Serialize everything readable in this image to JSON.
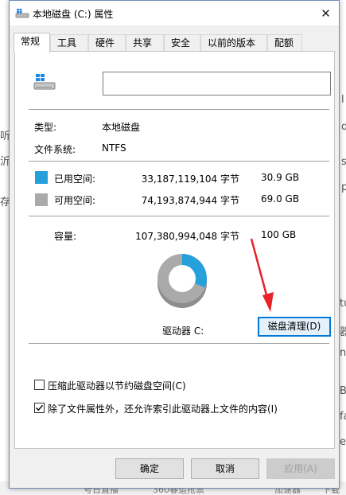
{
  "background": {
    "left_chars": [
      "听",
      "沂",
      "存"
    ],
    "right_chars": [
      "l",
      "d",
      "s",
      "p",
      "tu",
      "器",
      "ng",
      "Be",
      "fa",
      "e"
    ],
    "taskbar_items": [
      "号日直播",
      "360春运抢票",
      "加速器",
      "下载"
    ]
  },
  "window": {
    "title": "本地磁盘 (C:) 属性",
    "close_symbol": "✕"
  },
  "tabs": [
    {
      "label": "常规",
      "active": true
    },
    {
      "label": "工具",
      "active": false
    },
    {
      "label": "硬件",
      "active": false
    },
    {
      "label": "共享",
      "active": false
    },
    {
      "label": "安全",
      "active": false
    },
    {
      "label": "以前的版本",
      "active": false
    },
    {
      "label": "配额",
      "active": false
    }
  ],
  "general": {
    "volume_name_value": "",
    "type_label": "类型:",
    "type_value": "本地磁盘",
    "fs_label": "文件系统:",
    "fs_value": "NTFS",
    "used": {
      "label": "已用空间:",
      "bytes": "33,187,119,104 字节",
      "size": "30.9 GB",
      "color": "#26a0da"
    },
    "free": {
      "label": "可用空间:",
      "bytes": "74,193,874,944 字节",
      "size": "69.0 GB",
      "color": "#aaaaaa"
    },
    "capacity": {
      "label": "容量:",
      "bytes": "107,380,994,048 字节",
      "size": "100 GB"
    },
    "drive_label": "驱动器 C:",
    "cleanup_button": "磁盘清理(D)",
    "compress_label": "压缩此驱动器以节约磁盘空间(C)",
    "compress_checked": false,
    "index_label": "除了文件属性外，还允许索引此驱动器上文件的内容(I)",
    "index_checked": true
  },
  "usage_chart": {
    "used_fraction": 0.309,
    "used_color": "#26a0da",
    "free_color": "#aaaaaa"
  },
  "buttons": {
    "ok": "确定",
    "cancel": "取消",
    "apply": "应用(A)"
  },
  "annotation": {
    "arrow_color": "#e8212a"
  }
}
